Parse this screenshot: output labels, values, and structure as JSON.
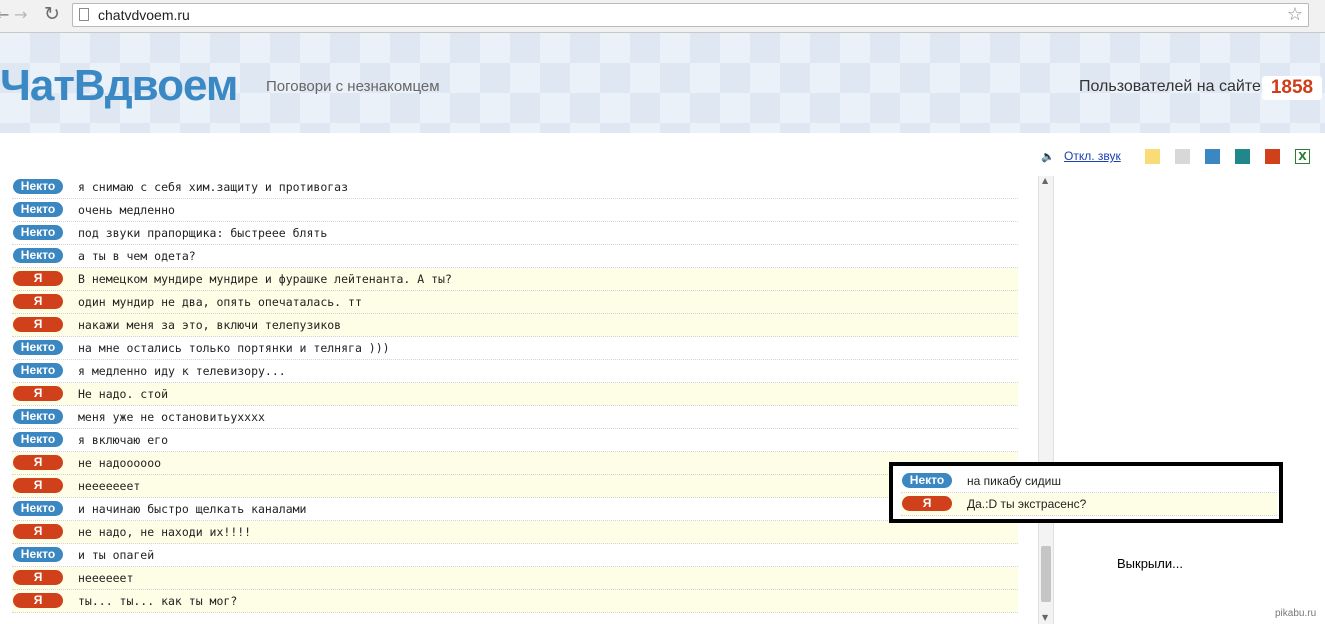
{
  "browser": {
    "url": "chatvdvoem.ru"
  },
  "header": {
    "logo": "ЧатВдвоем",
    "tagline": "Поговори с незнакомцем",
    "users_label": "Пользователей на сайте",
    "users_count": "1858"
  },
  "toolbar": {
    "sound_toggle": "Откл. звук",
    "theme_colors": [
      "#f9dc78",
      "#d8d8d8",
      "#3b87c1",
      "#21878a",
      "#d0401a"
    ]
  },
  "chat": {
    "messages": [
      {
        "sender": "Некто",
        "text": "я снимаю с себя хим.защиту и противогаз"
      },
      {
        "sender": "Некто",
        "text": "очень медленно"
      },
      {
        "sender": "Некто",
        "text": "под звуки прапорщика: быстреее блять"
      },
      {
        "sender": "Некто",
        "text": "а ты в чем одета?"
      },
      {
        "sender": "Я",
        "text": "В немецком мундире мундире и фурашке лейтенанта. А ты?"
      },
      {
        "sender": "Я",
        "text": "один мундир не два, опять опечаталась. тт"
      },
      {
        "sender": "Я",
        "text": "накажи меня за это, включи телепузиков"
      },
      {
        "sender": "Некто",
        "text": "на мне остались только портянки и телняга )))"
      },
      {
        "sender": "Некто",
        "text": "я медленно иду к телевизору..."
      },
      {
        "sender": "Я",
        "text": "Не надо. стой"
      },
      {
        "sender": "Некто",
        "text": "меня уже не остановитьухххх"
      },
      {
        "sender": "Некто",
        "text": "я включаю его"
      },
      {
        "sender": "Я",
        "text": "не надоооооо"
      },
      {
        "sender": "Я",
        "text": "нееееееет"
      },
      {
        "sender": "Некто",
        "text": "и начинаю быстро щелкать каналами"
      },
      {
        "sender": "Я",
        "text": "не надо, не находи их!!!!"
      },
      {
        "sender": "Некто",
        "text": "и ты опагей"
      },
      {
        "sender": "Я",
        "text": "нееееeет"
      },
      {
        "sender": "Я",
        "text": "ты... ты... как ты мог?"
      }
    ]
  },
  "callout": {
    "messages": [
      {
        "sender": "Некто",
        "text": "на пикабу сидиш"
      },
      {
        "sender": "Я",
        "text": "Да.:D ты экстрасенс?"
      }
    ],
    "caption": "Выкрыли..."
  },
  "watermark": "pikabu.ru"
}
